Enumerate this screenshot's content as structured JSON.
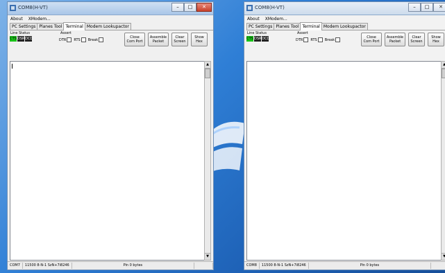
{
  "windows": [
    {
      "title": "COM8(H-VT)",
      "menu": [
        "About",
        "XModem..."
      ],
      "tabs": [
        "PC Settings",
        "Planes Tool",
        "Terminal",
        "Modem Lookupactor"
      ],
      "active_tab": 2,
      "line_status_label": "Line Status",
      "leds": [
        "CTS",
        "DSR",
        "DCD"
      ],
      "assert_label": "Assert",
      "dtr": "DTR",
      "rts": "RTS",
      "break_label": "Break",
      "buttons": [
        "Close\nCom Port",
        "Assemble\nPacket",
        "Clear\nScreen",
        "Show\nHex"
      ],
      "status": [
        "COM7",
        "11500 8-N-1  SzN+7i8246",
        "Pin 0 bytes",
        ""
      ]
    },
    {
      "title": "COM8(H-VT)",
      "menu": [
        "About",
        "XModem..."
      ],
      "tabs": [
        "PC Settings",
        "Planes Tool",
        "Terminal",
        "Modem Lookupactor"
      ],
      "active_tab": 2,
      "line_status_label": "Line Status",
      "leds": [
        "CTS",
        "DSR",
        "DCD"
      ],
      "assert_label": "Assert",
      "dtr": "DTR",
      "rts": "RTS",
      "break_label": "Break",
      "buttons": [
        "Close\nCom Port",
        "Assemble\nPacket",
        "Clear\nScreen",
        "Show\nHex"
      ],
      "status": [
        "COM8",
        "11500 8-N-1  SzN+7i8246",
        "Pin 0 bytes",
        ""
      ]
    }
  ],
  "window_controls": {
    "minimize": "–",
    "maximize": "□",
    "close": "✕"
  },
  "colors": {
    "led_on": "#19c219",
    "led_off": "#222222",
    "desktop": "#2f7fd6"
  }
}
